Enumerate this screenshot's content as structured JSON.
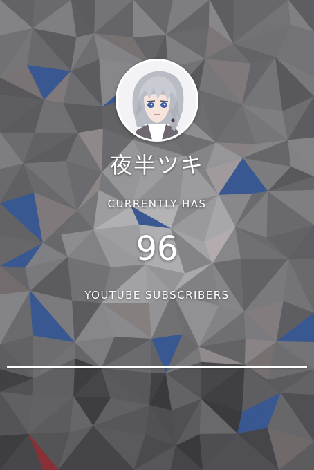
{
  "channel": {
    "name": "夜半ツキ",
    "subscriber_count": "96"
  },
  "labels": {
    "currently_has": "CURRENTLY HAS",
    "youtube_subscribers": "YOUTUBE SUBSCRIBERS"
  },
  "colors": {
    "text": "#ffffff",
    "divider": "#ffffff",
    "background_base": "#6b6a6d"
  },
  "icons": {
    "avatar": "channel-avatar-illustration"
  }
}
